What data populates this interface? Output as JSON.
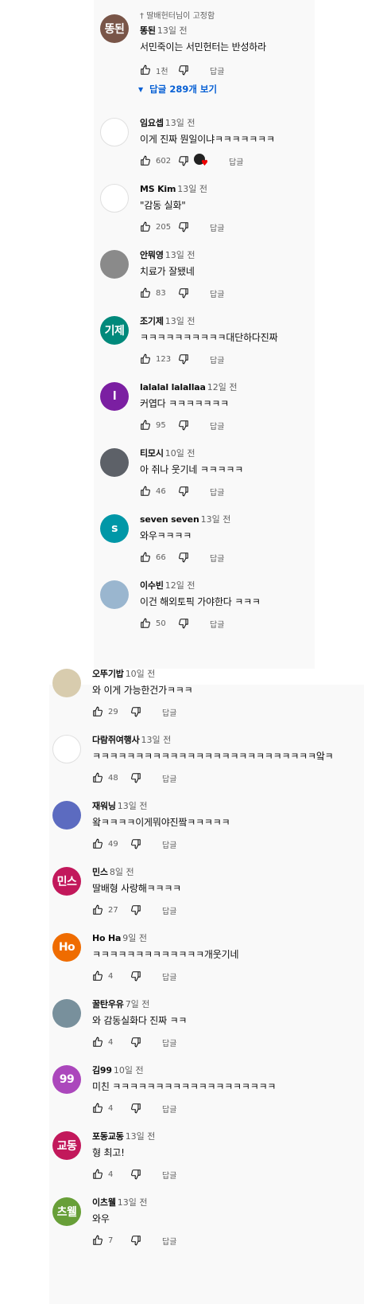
{
  "reply_label": "답글",
  "top": {
    "pinned": {
      "pin_icon": "pin-icon",
      "pinned_label": "딸배헌터님이 고정함",
      "avatar_text": "똥된",
      "avatar_color": "#795548",
      "author": "똥된",
      "time": "13일 전",
      "text": "서민죽이는 서민헌터는 반성하라",
      "likes": "1천",
      "replies_label": "답글 289개 보기"
    },
    "comments": [
      {
        "author": "임요셉",
        "time": "13일 전",
        "text": "이게 진짜 뭔일이냐ㅋㅋㅋㅋㅋㅋㅋ",
        "likes": "602",
        "avatar_text": "",
        "avatar_color": "#ffffff",
        "hearted": true
      },
      {
        "author": "MS Kim",
        "time": "13일 전",
        "text": "\"감동 실화\"",
        "likes": "205",
        "avatar_text": "",
        "avatar_color": "#ffffff"
      },
      {
        "author": "안뭐영",
        "time": "13일 전",
        "text": "치료가 잘됐네",
        "likes": "83",
        "avatar_text": "",
        "avatar_color": "#8a8a8a"
      },
      {
        "author": "조기제",
        "time": "13일 전",
        "text": "ㅋㅋㅋㅋㅋㅋㅋㅋㅋㅋ대단하다진짜",
        "likes": "123",
        "avatar_text": "기제",
        "avatar_color": "#00897b"
      },
      {
        "author": "lalalal lalallaa",
        "time": "12일 전",
        "text": "커엽다 ㅋㅋㅋㅋㅋㅋㅋ",
        "likes": "95",
        "avatar_text": "l",
        "avatar_color": "#7b1fa2"
      },
      {
        "author": "티모시",
        "time": "10일 전",
        "text": "아 쥐나 웃기네 ㅋㅋㅋㅋㅋ",
        "likes": "46",
        "avatar_text": "",
        "avatar_color": "#5d6168"
      },
      {
        "author": "seven seven",
        "time": "13일 전",
        "text": "와우ㅋㅋㅋㅋ",
        "likes": "66",
        "avatar_text": "s",
        "avatar_color": "#0097a7"
      },
      {
        "author": "이수빈",
        "time": "12일 전",
        "text": "이건 해외토픽 가야한다 ㅋㅋㅋ",
        "likes": "50",
        "avatar_text": "",
        "avatar_color": "#9ab6cf"
      }
    ]
  },
  "bottom": {
    "comments": [
      {
        "author": "오뚜기밥",
        "time": "10일 전",
        "text": "와 이게 가능한건가ㅋㅋㅋ",
        "likes": "29",
        "avatar_text": "",
        "avatar_color": "#d8ccae"
      },
      {
        "author": "다람쥐여행사",
        "time": "13일 전",
        "text": "ㅋㅋㅋㅋㅋㅋㅋㅋㅋㅋㅋㅋㅋㅋㅋㅋㅋㅋㅋㅋㅋㅋㅋㅋㅋㅋ앜ㅋ",
        "likes": "48",
        "avatar_text": "",
        "avatar_color": "#ffffff"
      },
      {
        "author": "재워닝",
        "time": "13일 전",
        "text": "왘ㅋㅋㅋㅋ이게뭐야진짴ㅋㅋㅋㅋㅋ",
        "likes": "49",
        "avatar_text": "",
        "avatar_color": "#5c6bc0"
      },
      {
        "author": "민스",
        "time": "8일 전",
        "text": "딸배형 사랑해ㅋㅋㅋㅋ",
        "likes": "27",
        "avatar_text": "민스",
        "avatar_color": "#c2185b"
      },
      {
        "author": "Ho Ha",
        "time": "9일 전",
        "text": "ㅋㅋㅋㅋㅋㅋㅋㅋㅋㅋㅋㅋㅋ개웃기네",
        "likes": "4",
        "avatar_text": "Ho",
        "avatar_color": "#ef6c00"
      },
      {
        "author": "꿀탄우유",
        "time": "7일 전",
        "text": "와 감동실화다 진짜 ㅋㅋ",
        "likes": "4",
        "avatar_text": "",
        "avatar_color": "#78909c"
      },
      {
        "author": "김99",
        "time": "10일 전",
        "text": "미친 ㅋㅋㅋㅋㅋㅋㅋㅋㅋㅋㅋㅋㅋㅋㅋㅋㅋㅋㅋ",
        "likes": "4",
        "avatar_text": "99",
        "avatar_color": "#ab47bc"
      },
      {
        "author": "포동교동",
        "time": "13일 전",
        "text": "형 최고!",
        "likes": "4",
        "avatar_text": "교동",
        "avatar_color": "#c2185b"
      },
      {
        "author": "이츠웰",
        "time": "13일 전",
        "text": "와우",
        "likes": "7",
        "avatar_text": "츠웰",
        "avatar_color": "#689f38"
      }
    ]
  }
}
